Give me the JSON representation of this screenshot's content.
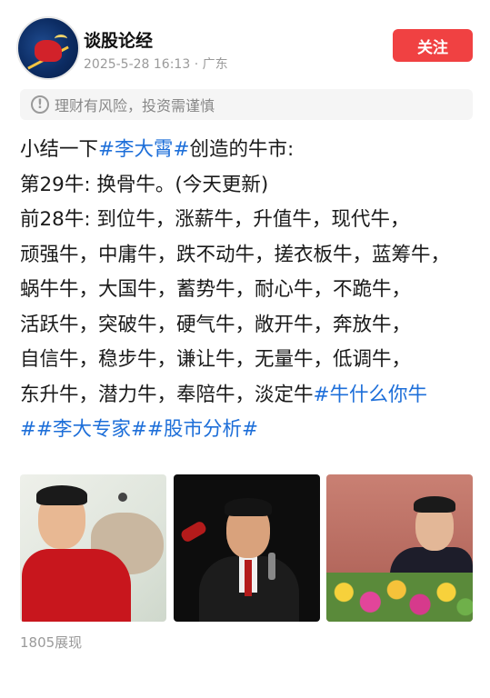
{
  "author": {
    "name": "谈股论经",
    "timestamp": "2025-5-28 16:13",
    "location": "广东",
    "meta_separator": " · "
  },
  "follow_button": {
    "label": "关注"
  },
  "risk_notice": {
    "icon": "exclamation-circle-icon",
    "text": "理财有风险，投资需谨慎"
  },
  "post": {
    "lines": [
      {
        "segments": [
          {
            "text": "小结一下",
            "tag": false
          },
          {
            "text": "#李大霄#",
            "tag": true
          },
          {
            "text": "创造的牛市:",
            "tag": false
          }
        ]
      },
      {
        "segments": [
          {
            "text": "第29牛: 换骨牛。(今天更新)",
            "tag": false
          }
        ]
      },
      {
        "segments": [
          {
            "text": "前28牛: 到位牛，涨薪牛，升值牛，现代牛，",
            "tag": false
          }
        ]
      },
      {
        "segments": [
          {
            "text": "顽强牛，中庸牛，跌不动牛，搓衣板牛，蓝筹牛，",
            "tag": false
          }
        ]
      },
      {
        "segments": [
          {
            "text": "蜗牛牛，大国牛，蓄势牛，耐心牛，不跪牛，",
            "tag": false
          }
        ]
      },
      {
        "segments": [
          {
            "text": "活跃牛，突破牛，硬气牛，敞开牛，奔放牛，",
            "tag": false
          }
        ]
      },
      {
        "segments": [
          {
            "text": "自信牛，稳步牛，谦让牛，无量牛，低调牛，",
            "tag": false
          }
        ]
      },
      {
        "segments": [
          {
            "text": "东升牛，潜力牛，奉陪牛，淡定牛",
            "tag": false
          },
          {
            "text": "#牛什么你牛",
            "tag": true
          }
        ]
      },
      {
        "segments": [
          {
            "text": "##李大专家##股市分析#",
            "tag": true
          }
        ]
      }
    ]
  },
  "images": [
    {
      "name": "photo-man-red-shirt-with-bull"
    },
    {
      "name": "photo-man-speaking-with-microphone"
    },
    {
      "name": "photo-man-with-flowers"
    }
  ],
  "stats": {
    "views": "1805展现"
  },
  "colors": {
    "accent_red": "#f04142",
    "tag_blue": "#1e6fd9",
    "meta_gray": "#9a9a9a"
  }
}
